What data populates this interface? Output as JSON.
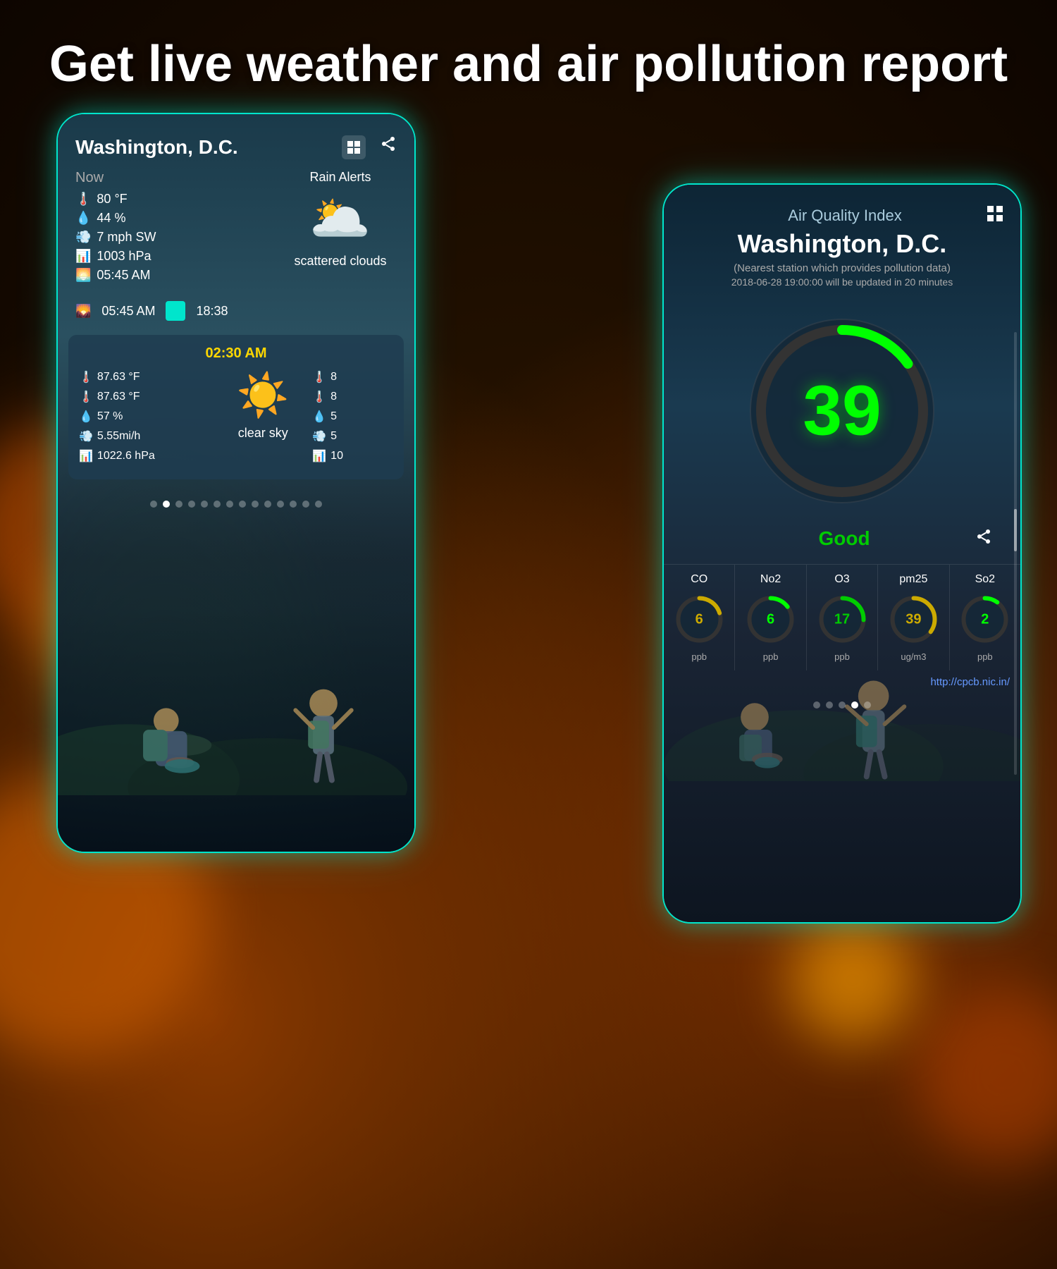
{
  "page": {
    "title": "Get live weather and air pollution report",
    "background_color": "#1a0a00"
  },
  "weather_phone": {
    "city": "Washington, D.C.",
    "header_icons": [
      "grid",
      "share"
    ],
    "now_section": {
      "label": "Now",
      "temperature": "80 °F",
      "humidity": "44 %",
      "wind": "7 mph SW",
      "pressure": "1003 hPa",
      "sunrise": "05:45 AM"
    },
    "rain_alerts": {
      "label": "Rain Alerts",
      "condition": "scattered clouds",
      "sunset": "18:38"
    },
    "forecast": {
      "time": "02:30 AM",
      "temp_max": "87.63 °F",
      "temp_min": "87.63 °F",
      "humidity": "57 %",
      "wind": "5.55mi/h",
      "pressure": "1022.6 hPa",
      "condition": "clear sky",
      "right_values": [
        "8",
        "8",
        "5",
        "5",
        "10"
      ]
    },
    "pagination": {
      "total": 14,
      "active": 2
    }
  },
  "aqi_phone": {
    "title": "Air Quality Index",
    "city": "Washington, D.C.",
    "subtitle": "(Nearest station which provides pollution data)",
    "timestamp": "2018-06-28 19:00:00 will be updated in 20 minutes",
    "aqi_value": "39",
    "aqi_status": "Good",
    "aqi_color": "#00ff00",
    "share_icon": "share",
    "gauge_track_color": "#333",
    "gauge_fill_color": "#00ff00",
    "gauge_percentage": 15,
    "pollutants": [
      {
        "name": "CO",
        "value": "6",
        "unit": "ppb",
        "color": "#ccaa00",
        "percentage": 20
      },
      {
        "name": "No2",
        "value": "6",
        "unit": "ppb",
        "color": "#00ff00",
        "percentage": 15
      },
      {
        "name": "O3",
        "value": "17",
        "unit": "ppb",
        "color": "#00cc00",
        "percentage": 25
      },
      {
        "name": "pm25",
        "value": "39",
        "unit": "ug/m3",
        "color": "#ccaa00",
        "percentage": 35
      },
      {
        "name": "So2",
        "value": "2",
        "unit": "ppb",
        "color": "#00ff00",
        "percentage": 10
      }
    ],
    "source_link": "http://cpcb.nic.in/",
    "pagination": {
      "total": 5,
      "active": 4
    }
  }
}
